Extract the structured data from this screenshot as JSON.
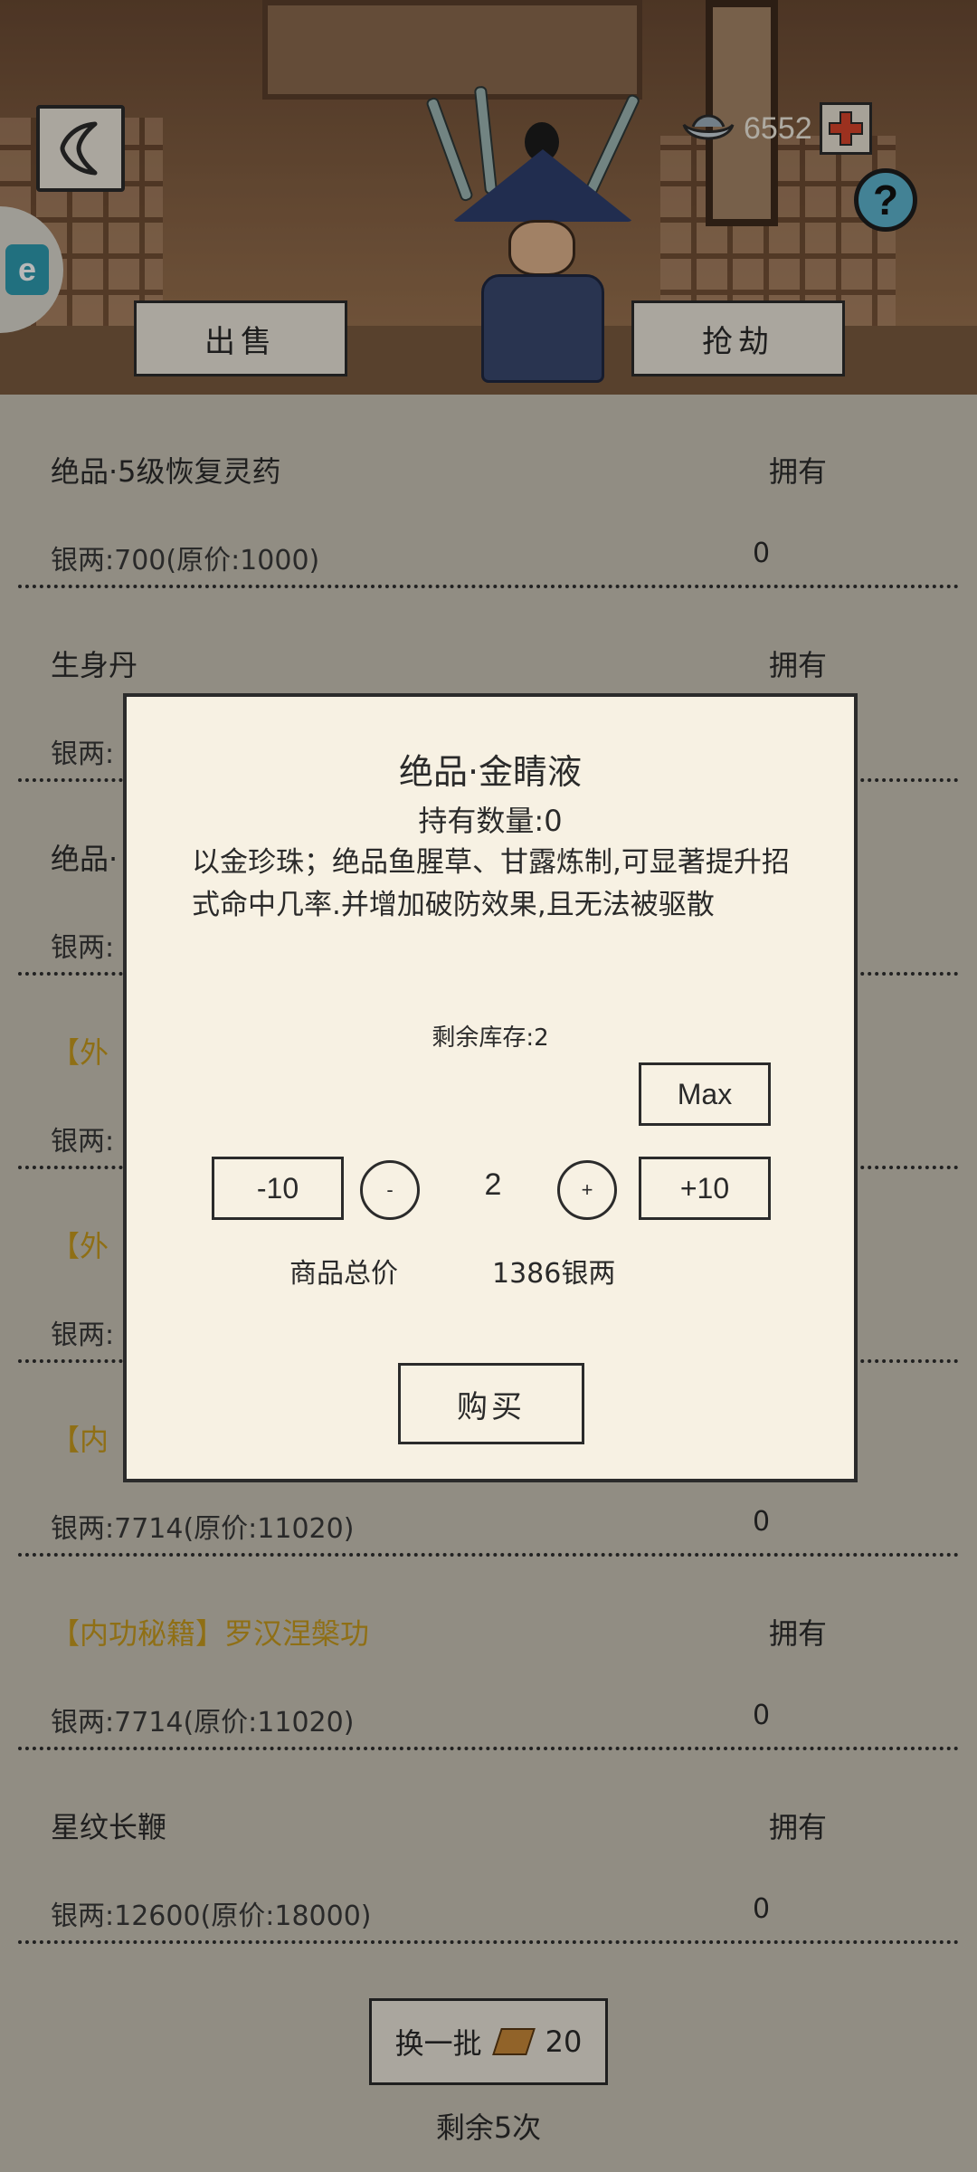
{
  "header": {
    "currency_amount": "6552",
    "sell_label": "出售",
    "rob_label": "抢劫",
    "help_label": "?",
    "badge_label": "e"
  },
  "items": [
    {
      "name": "绝品·5级恢复灵药",
      "gold": false,
      "own_label": "拥有",
      "price": "银两:700(原价:1000)",
      "owned": "0"
    },
    {
      "name": "生身丹",
      "gold": false,
      "own_label": "拥有",
      "price": "银两:",
      "owned": ""
    },
    {
      "name": "绝品·",
      "gold": false,
      "own_label": "",
      "price": "银两:",
      "owned": ""
    },
    {
      "name": "【外",
      "gold": true,
      "own_label": "",
      "price": "银两:",
      "owned": ""
    },
    {
      "name": "【外",
      "gold": true,
      "own_label": "",
      "price": "银两:",
      "owned": ""
    },
    {
      "name": "【内",
      "gold": true,
      "own_label": "",
      "price": "银两:7714(原价:11020)",
      "owned": "0"
    },
    {
      "name": "【内功秘籍】罗汉涅槃功",
      "gold": true,
      "own_label": "拥有",
      "price": "银两:7714(原价:11020)",
      "owned": "0"
    },
    {
      "name": "星纹长鞭",
      "gold": false,
      "own_label": "拥有",
      "price": "银两:12600(原价:18000)",
      "owned": "0"
    }
  ],
  "footer": {
    "refresh_label": "换一批",
    "refresh_cost": "20",
    "remaining": "剩余5次"
  },
  "modal": {
    "title": "绝品·金睛液",
    "hold_count": "持有数量:0",
    "description": "以金珍珠；绝品鱼腥草、甘露炼制,可显著提升招式命中几率.并增加破防效果,且无法被驱散",
    "stock": "剩余库存:2",
    "max_label": "Max",
    "minus10_label": "-10",
    "minus_label": "-",
    "quantity": "2",
    "plus_label": "+",
    "plus10_label": "+10",
    "total_label": "商品总价",
    "total_value": "1386银两",
    "buy_label": "购买"
  },
  "colors": {
    "panel": "#f7f1e3",
    "list_bg": "#c9c4b6",
    "gold_text": "#c79a1e",
    "help_button": "#5db4cf"
  }
}
